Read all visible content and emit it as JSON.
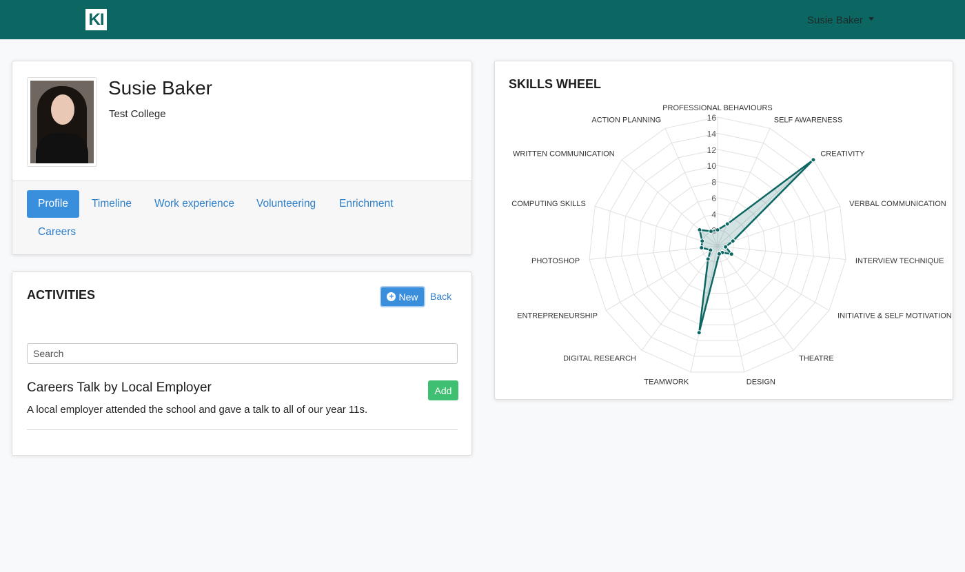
{
  "navbar": {
    "logo_text": "KI",
    "user_name": "Susie Baker",
    "background": "#0c6662"
  },
  "profile": {
    "name": "Susie Baker",
    "college": "Test College",
    "tabs": [
      {
        "label": "Profile",
        "active": true
      },
      {
        "label": "Timeline",
        "active": false
      },
      {
        "label": "Work experience",
        "active": false
      },
      {
        "label": "Volunteering",
        "active": false
      },
      {
        "label": "Enrichment",
        "active": false
      },
      {
        "label": "Careers",
        "active": false
      }
    ]
  },
  "activities": {
    "title": "ACTIVITIES",
    "new_label": "New",
    "back_label": "Back",
    "search_placeholder": "Search",
    "items": [
      {
        "title": "Careers Talk by Local Employer",
        "description": "A local employer attended the school and gave a talk to all of our year 11s.",
        "add_label": "Add"
      }
    ]
  },
  "skills": {
    "title": "SKILLS WHEEL"
  },
  "colors": {
    "accent": "#3a8fdc",
    "success": "#3fbf72",
    "series": "#0c6662",
    "link": "#2e7fc9"
  },
  "chart_data": {
    "type": "radar",
    "title": "SKILLS WHEEL",
    "categories": [
      "PROFESSIONAL BEHAVIOURS",
      "SELF AWARENESS",
      "CREATIVITY",
      "VERBAL COMMUNICATION",
      "INTERVIEW TECHNIQUE",
      "INITIATIVE & SELF MOTIVATION",
      "THEATRE",
      "DESIGN",
      "TEAMWORK",
      "DIGITAL RESEARCH",
      "ENTREPRENEURSHIP",
      "PHOTOSHOP",
      "COMPUTING SKILLS",
      "WRITTEN COMMUNICATION",
      "ACTION PLANNING"
    ],
    "ticks": [
      "2",
      "4",
      "6",
      "8",
      "10",
      "12",
      "14",
      "16"
    ],
    "rlim": [
      0,
      16
    ],
    "series": [
      {
        "values": [
          2,
          3,
          16,
          2,
          1,
          2,
          1,
          1,
          11,
          2,
          1,
          2,
          2,
          3,
          2
        ]
      }
    ],
    "grid": true
  }
}
